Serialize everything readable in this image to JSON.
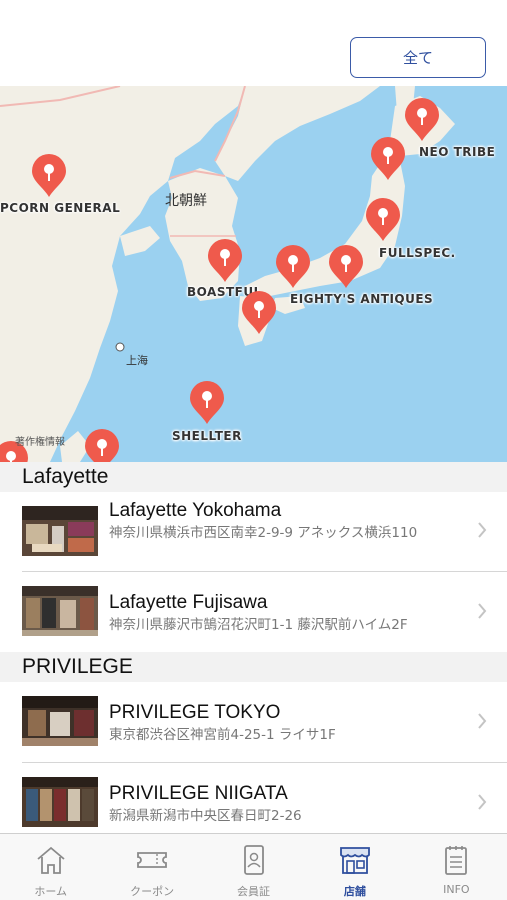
{
  "header": {
    "filter_button": "全て"
  },
  "map": {
    "geo_labels": {
      "north_korea": "北朝鮮",
      "shanghai": "上海"
    },
    "legal": "著作権情報",
    "pins": [
      {
        "id": "popcorn",
        "label": "PCORN GENERAL"
      },
      {
        "id": "neo",
        "label": "NEO TRIBE"
      },
      {
        "id": "fullspec",
        "label": "FULLSPEC."
      },
      {
        "id": "boastful",
        "label": "BOASTFUL"
      },
      {
        "id": "eightys",
        "label": "EIGHTY'S ANTIQUES"
      },
      {
        "id": "shellter",
        "label": "SHELLTER"
      }
    ],
    "colors": {
      "sea": "#9bd1f0",
      "land": "#f2efe6",
      "pin": "#ef5a4c",
      "border": "#f1b9b4"
    }
  },
  "sections": [
    {
      "title": "Lafayette",
      "stores": [
        {
          "name": "Lafayette Yokohama",
          "address": "神奈川県横浜市西区南幸2-9-9 アネックス横浜110"
        },
        {
          "name": "Lafayette Fujisawa",
          "address": "神奈川県藤沢市鵠沼花沢町1-1 藤沢駅前ハイム2F"
        }
      ]
    },
    {
      "title": "PRIVILEGE",
      "stores": [
        {
          "name": "PRIVILEGE TOKYO",
          "address": "東京都渋谷区神宮前4-25-1 ライサ1F"
        },
        {
          "name": "PRIVILEGE NIIGATA",
          "address": "新潟県新潟市中央区春日町2-26"
        }
      ]
    }
  ],
  "tabbar": {
    "tabs": [
      {
        "label": "ホーム",
        "icon": "home-icon"
      },
      {
        "label": "クーポン",
        "icon": "ticket-icon"
      },
      {
        "label": "会員証",
        "icon": "member-card-icon"
      },
      {
        "label": "店舗",
        "icon": "store-icon",
        "active": true
      },
      {
        "label": "INFO",
        "icon": "info-icon"
      }
    ],
    "active_color": "#2f4f9e"
  }
}
